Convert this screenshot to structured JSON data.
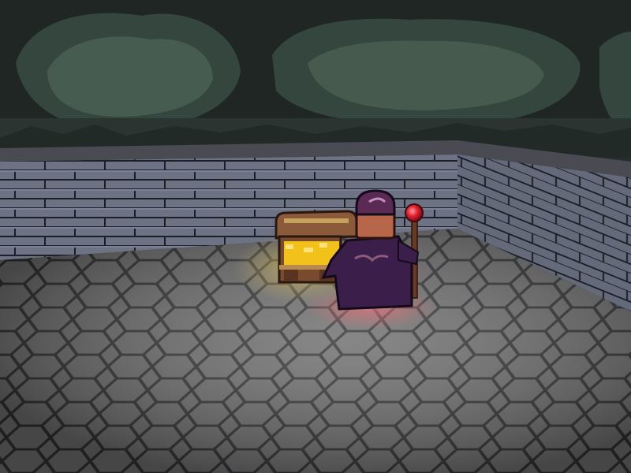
{
  "scene": {
    "palette": {
      "cave_dark": "#1f2624",
      "cave_mid": "#34463d",
      "cave_light": "#587060",
      "wall_top": "#4a4a52",
      "brick": "#6d7384",
      "mortar": "#1d1f27",
      "floor": "#6c6c6c",
      "floor_line": "#2f3032",
      "chest_wood": "#8a5a3a",
      "gold": "#f2c21b",
      "robe": "#3b1f4a",
      "hood": "#5a2a55",
      "face": "#b8664a",
      "staff": "#6a3a22",
      "orb": "#e0202e",
      "glow": "#ff6f7a"
    },
    "objects": {
      "background": "cave-forest",
      "walls": "stone-brick",
      "floor": "stone-tile",
      "chest": "open-treasure-chest",
      "character": "wizard-with-staff"
    }
  }
}
